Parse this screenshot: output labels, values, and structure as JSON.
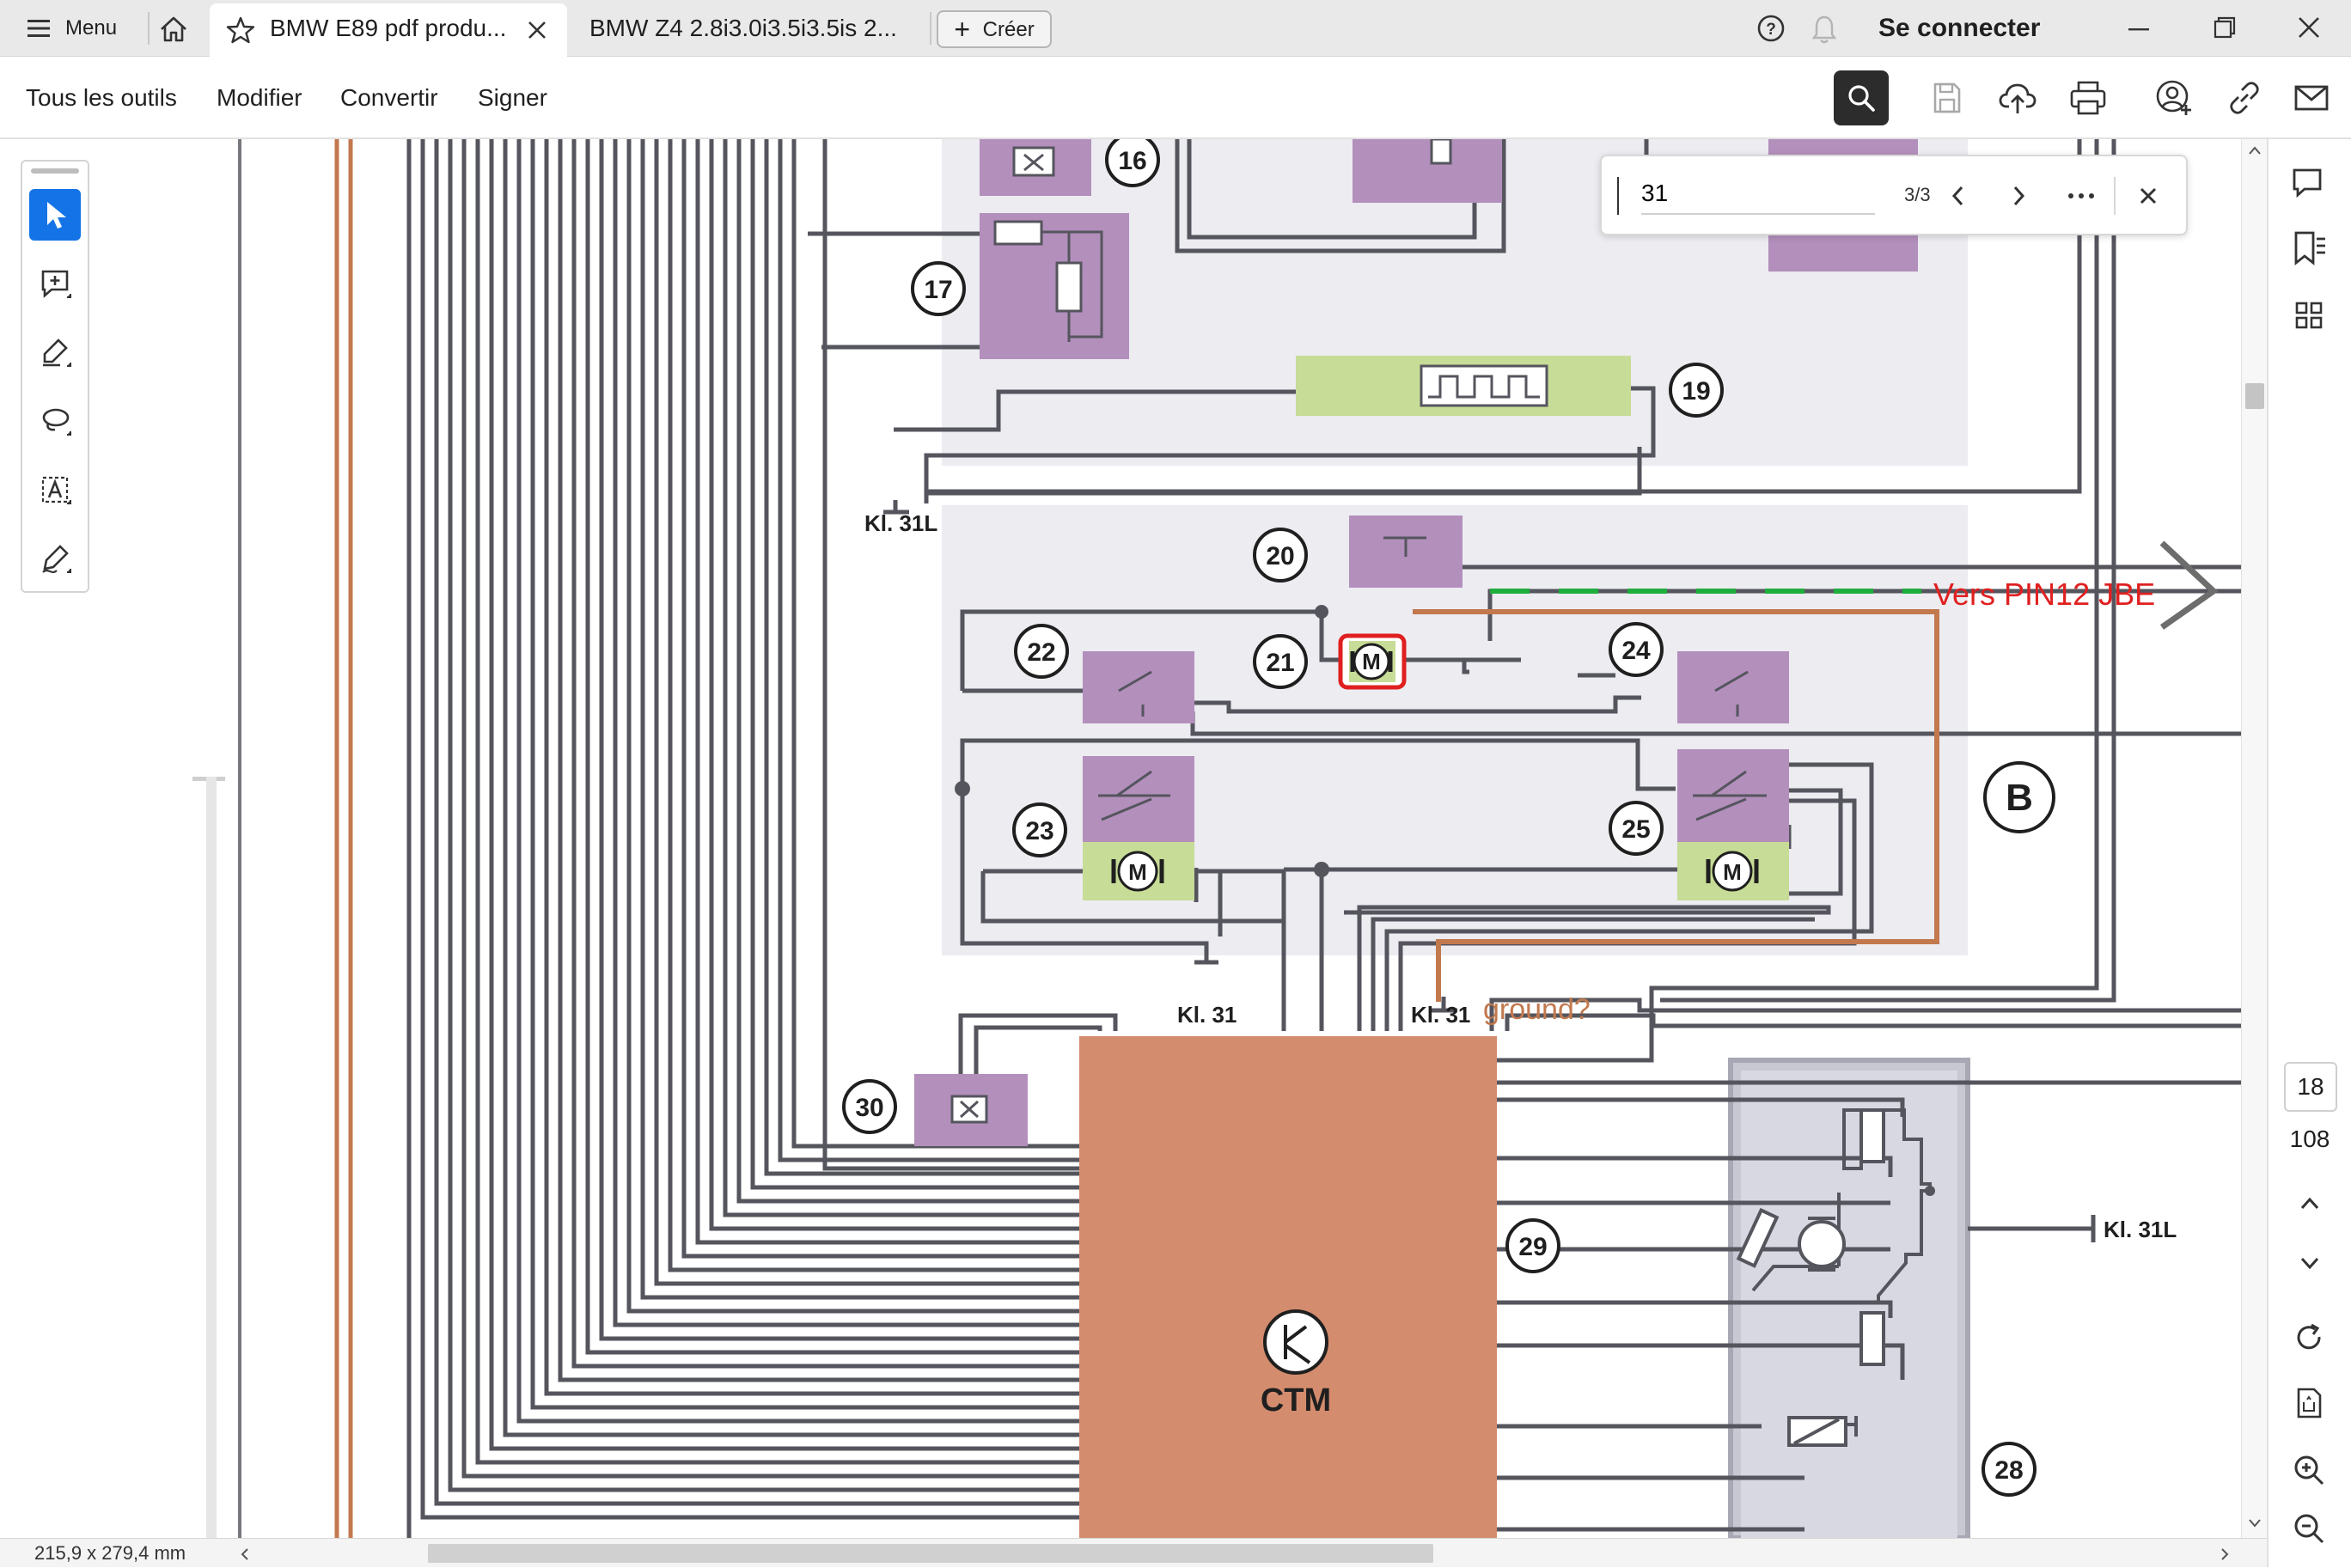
{
  "tabbar": {
    "menu_label": "Menu",
    "tabs": [
      {
        "label": "BMW E89 pdf produ..."
      },
      {
        "label": "BMW Z4 2.8i3.0i3.5i3.5is 2..."
      }
    ],
    "create_label": "Créer",
    "signin_label": "Se connecter"
  },
  "toolbar": {
    "menus": [
      "Tous les outils",
      "Modifier",
      "Convertir",
      "Signer"
    ]
  },
  "findbar": {
    "query": "31",
    "result_count": "3/3"
  },
  "pager": {
    "current_page": "18",
    "total_pages": "108"
  },
  "statusbar": {
    "page_size": "215,9 x 279,4 mm"
  },
  "diagram": {
    "labels": {
      "n16": "16",
      "n17": "17",
      "n19": "19",
      "n20": "20",
      "n21": "21",
      "n22": "22",
      "n23": "23",
      "n24": "24",
      "n25": "25",
      "n28": "28",
      "n29": "29",
      "n30": "30",
      "kl31l_top": "Kl. 31L",
      "kl31_a": "Kl. 31",
      "kl31_b": "Kl. 31",
      "kl31l_right": "Kl. 31L",
      "section_b": "B",
      "ctm": "CTM",
      "motor": "M"
    },
    "annotations": {
      "vers_pin": "Vers PIN12 JBE",
      "ground": "ground?"
    },
    "colors": {
      "purple": "#b38fbc",
      "green": "#c7dc96",
      "ctm": "#d48c6e",
      "bg_block": "#ececf1",
      "wire": "#55555e",
      "orange_wire": "#c2794e",
      "red": "#e02020",
      "highlight_green": "#1fae3d"
    }
  }
}
